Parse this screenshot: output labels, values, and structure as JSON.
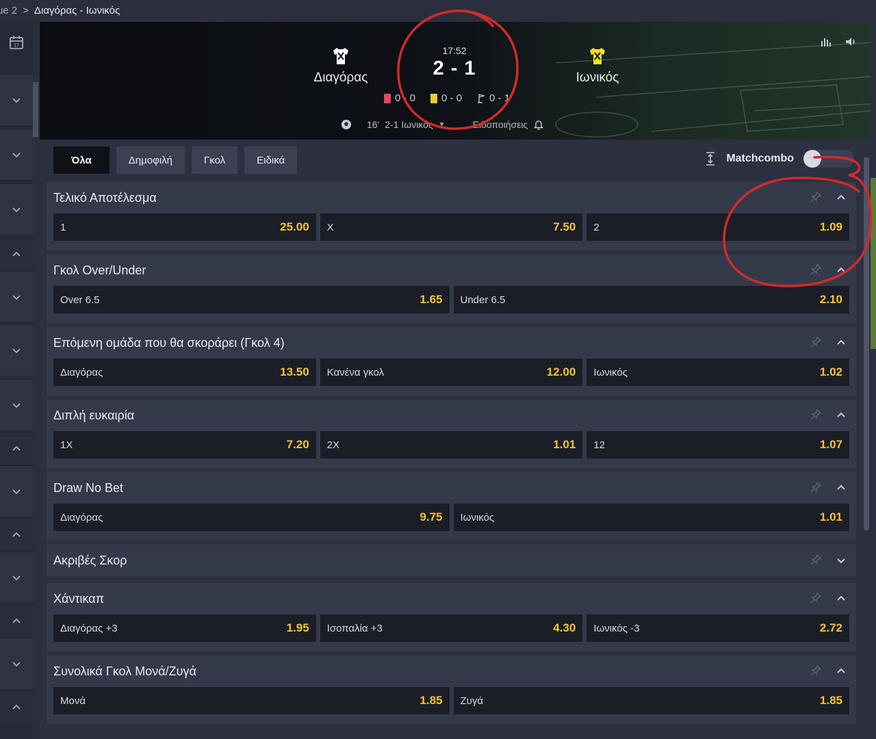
{
  "breadcrumb": {
    "prev": "ue 2",
    "separator": ">",
    "current": "Διαγόρας - Ιωνικός"
  },
  "match": {
    "home": "Διαγόρας",
    "away": "Ιωνικός",
    "clock": "17:52",
    "score": "2 - 1",
    "red_cards": "0 - 0",
    "yellow_cards": "0 - 0",
    "corners": "0 - 1",
    "last_event_minute": "16'",
    "last_event_text": "2-1 Ιωνικός",
    "notifications_label": "Ειδοποιήσεις",
    "home_shirt_color": "#ffffff",
    "away_shirt_color": "#f2e12a"
  },
  "tabs": [
    {
      "label": "Όλα",
      "active": true
    },
    {
      "label": "Δημοφιλή"
    },
    {
      "label": "Γκολ"
    },
    {
      "label": "Ειδικά"
    }
  ],
  "matchcombo_label": "Matchcombo",
  "markets": [
    {
      "title": "Τελικό Αποτέλεσμα",
      "expanded": true,
      "selections": [
        {
          "label": "1",
          "price": "25.00"
        },
        {
          "label": "X",
          "price": "7.50"
        },
        {
          "label": "2",
          "price": "1.09"
        }
      ]
    },
    {
      "title": "Γκολ Over/Under",
      "expanded": true,
      "selections": [
        {
          "label": "Over 6.5",
          "price": "1.65"
        },
        {
          "label": "Under 6.5",
          "price": "2.10"
        }
      ]
    },
    {
      "title": "Επόμενη ομάδα που θα σκοράρει (Γκολ 4)",
      "expanded": true,
      "selections": [
        {
          "label": "Διαγόρας",
          "price": "13.50"
        },
        {
          "label": "Κανένα γκολ",
          "price": "12.00"
        },
        {
          "label": "Ιωνικός",
          "price": "1.02"
        }
      ]
    },
    {
      "title": "Διπλή ευκαιρία",
      "expanded": true,
      "selections": [
        {
          "label": "1X",
          "price": "7.20"
        },
        {
          "label": "2X",
          "price": "1.01"
        },
        {
          "label": "12",
          "price": "1.07"
        }
      ]
    },
    {
      "title": "Draw No Bet",
      "expanded": true,
      "selections": [
        {
          "label": "Διαγόρας",
          "price": "9.75"
        },
        {
          "label": "Ιωνικός",
          "price": "1.01"
        }
      ]
    },
    {
      "title": "Ακριβές Σκορ",
      "expanded": false,
      "selections": []
    },
    {
      "title": "Χάντικαπ",
      "expanded": true,
      "selections": [
        {
          "label": "Διαγόρας +3",
          "price": "1.95"
        },
        {
          "label": "Ισοπαλία +3",
          "price": "4.30"
        },
        {
          "label": "Ιωνικός -3",
          "price": "2.72"
        }
      ]
    },
    {
      "title": "Συνολικά Γκολ Μονά/Ζυγά",
      "expanded": true,
      "selections": [
        {
          "label": "Μονά",
          "price": "1.85"
        },
        {
          "label": "Ζυγά",
          "price": "1.85"
        }
      ]
    }
  ],
  "colors": {
    "accent_price": "#f4c531",
    "annotation": "#d42a2a"
  }
}
